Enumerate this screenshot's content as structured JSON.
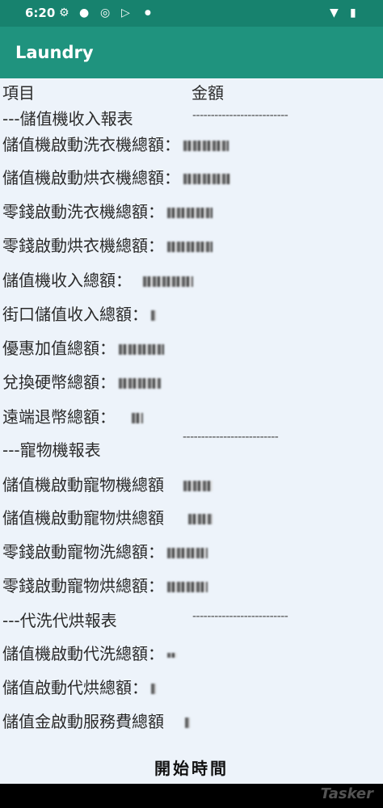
{
  "status": {
    "time": "6:20"
  },
  "app": {
    "title": "Laundry"
  },
  "header": {
    "col1": "項目",
    "col2": "金額"
  },
  "sections": {
    "stored": {
      "title": "---儲值機收入報表",
      "items": [
        "儲值機啟動洗衣機總額：",
        "儲值機啟動烘衣機總額：",
        "零錢啟動洗衣機總額：",
        "零錢啟動烘衣機總額：",
        "儲值機收入總額：",
        "街口儲值收入總額：",
        "優惠加值總額：",
        "兌換硬幣總額：",
        "遠端退幣總額："
      ]
    },
    "pet": {
      "title": "---寵物機報表",
      "items": [
        "儲值機啟動寵物機總額",
        "儲值機啟動寵物烘總額",
        "零錢啟動寵物洗總額：",
        "零錢啟動寵物烘總額："
      ]
    },
    "proxy": {
      "title": "---代洗代烘報表",
      "items": [
        "儲值機啟動代洗總額：",
        "儲值啟動代烘總額：",
        "儲值金啟動服務費總額"
      ]
    }
  },
  "dashes": "--------------------------",
  "bottom_button": "開始時間",
  "watermark": "Tasker"
}
